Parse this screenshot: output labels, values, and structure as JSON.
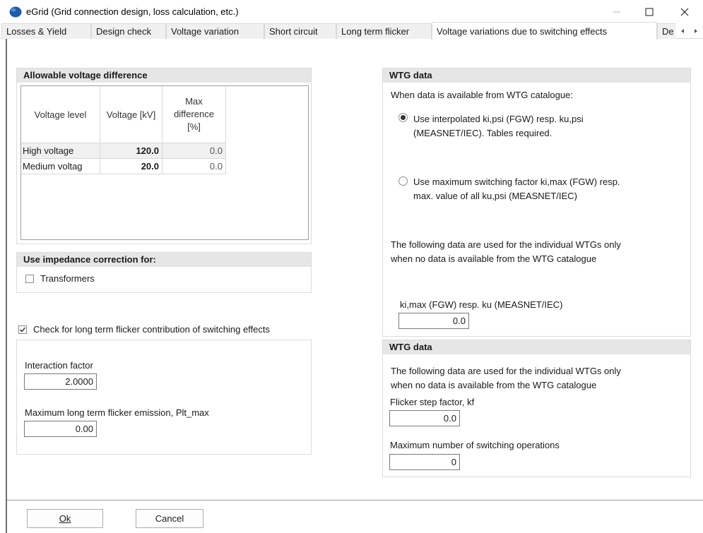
{
  "window": {
    "title": "eGrid (Grid connection design, loss calculation, etc.)",
    "icon": "globe-icon",
    "controls": {
      "minimize": "—",
      "maximize": "☐",
      "close": "✕"
    }
  },
  "tabs": [
    {
      "label": "Losses & Yield"
    },
    {
      "label": "Design check"
    },
    {
      "label": "Voltage variation"
    },
    {
      "label": "Short circuit"
    },
    {
      "label": "Long term flicker"
    },
    {
      "label": "Voltage variations due to switching effects",
      "active": true
    },
    {
      "label": "De"
    }
  ],
  "voltage_group": {
    "title": "Allowable voltage difference",
    "columns": [
      "Voltage level",
      "Voltage [kV]",
      "Max difference [%]"
    ],
    "rows": [
      {
        "level": "High voltage",
        "voltage": "120.0",
        "max_diff": "0.0"
      },
      {
        "level": "Medium voltag",
        "voltage": "20.0",
        "max_diff": "0.0"
      }
    ]
  },
  "impedance_group": {
    "title": "Use impedance correction for:",
    "transformers_label": "Transformers",
    "transformers_checked": false
  },
  "flicker_check": {
    "label": "Check for long term flicker contribution of switching effects",
    "checked": true,
    "interaction_label": "Interaction factor",
    "interaction_value": "2.0000",
    "plt_label": "Maximum long term flicker emission, Plt_max",
    "plt_value": "0.00"
  },
  "wtg_data_1": {
    "title": "WTG data",
    "intro": "When data is available from WTG catalogue:",
    "option1_line1": "Use interpolated ki,psi (FGW) resp. ku,psi",
    "option1_line2": "(MEASNET/IEC). Tables required.",
    "option1_selected": true,
    "option2_line1": "Use maximum switching factor ki,max (FGW) resp.",
    "option2_line2": "max. value of all ku,psi (MEASNET/IEC)",
    "note_line1": "The following data are used for the individual WTGs only",
    "note_line2": "when no data is available from the WTG catalogue",
    "kimax_label": "ki,max (FGW) resp. ku (MEASNET/IEC)",
    "kimax_value": "0.0"
  },
  "wtg_data_2": {
    "title": "WTG data",
    "note_line1": "The following data are used for the individual WTGs only",
    "note_line2": "when no data is available from the WTG catalogue",
    "kf_label": "Flicker step factor, kf",
    "kf_value": "0.0",
    "max_ops_label": "Maximum number of switching operations",
    "max_ops_value": "0"
  },
  "buttons": {
    "ok_label": "Ok",
    "cancel_label": "Cancel"
  },
  "colors": {
    "group_header_bg": "#e6e6e6",
    "tab_bg": "#f0f0f0",
    "icon_blue": "#1e5aa8"
  }
}
